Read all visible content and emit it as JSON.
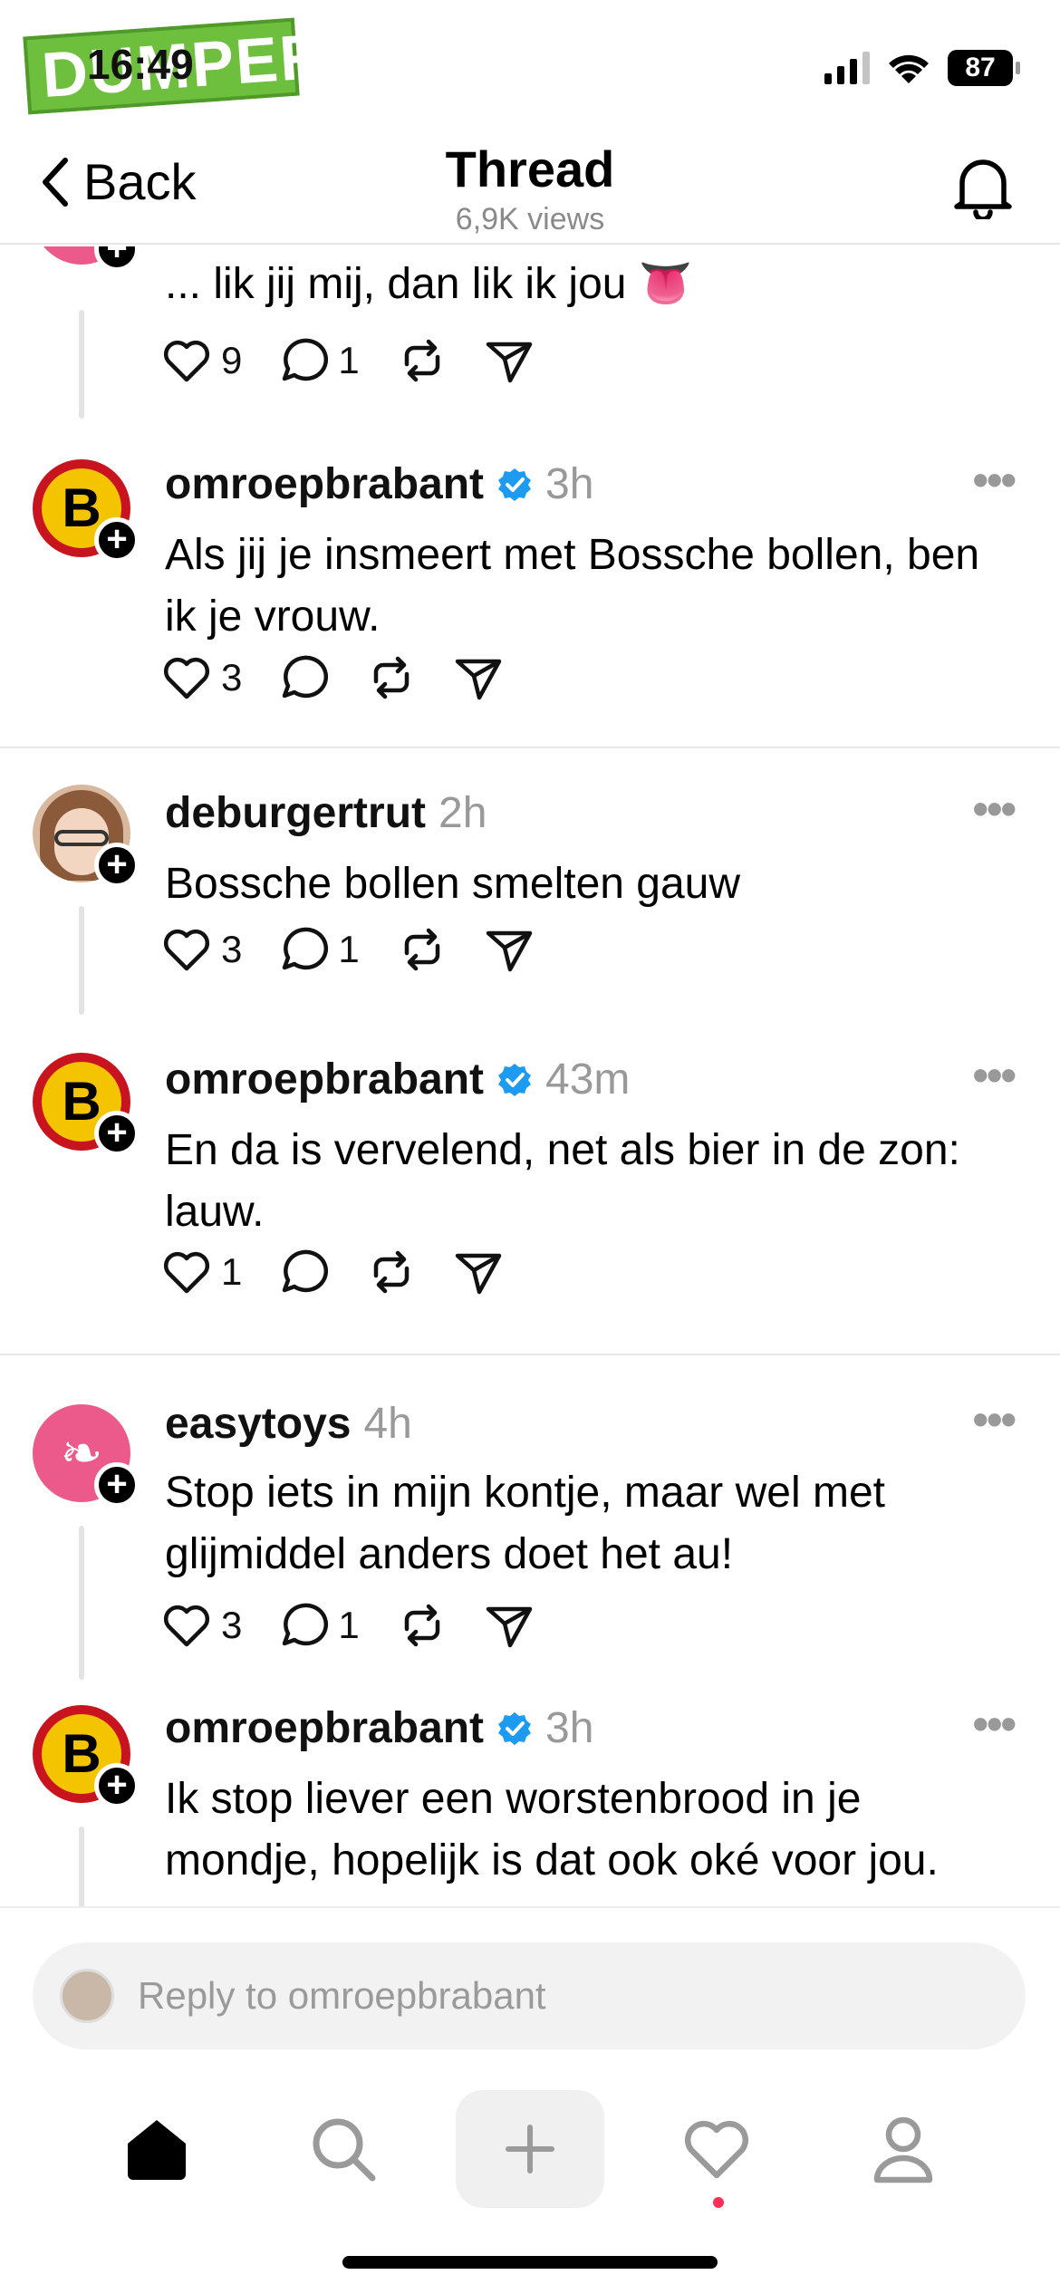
{
  "status_bar": {
    "watermark": "DUMPERT",
    "time": "16:49",
    "battery": "87"
  },
  "header": {
    "back_label": "Back",
    "title": "Thread",
    "views": "6,9K views"
  },
  "posts": [
    {
      "id": "partial",
      "username": "",
      "text": "... lik jij mij, dan lik ik jou 👅",
      "likes": "9",
      "replies": "1",
      "avatar": "easytoys"
    },
    {
      "id": "p1",
      "username": "omroepbrabant",
      "verified": true,
      "time": "3h",
      "text": "Als jij je insmeert met Bossche bollen, ben ik je vrouw.",
      "likes": "3",
      "replies": "",
      "avatar": "B"
    },
    {
      "id": "p2",
      "username": "deburgertrut",
      "verified": false,
      "time": "2h",
      "text": "Bossche bollen smelten gauw",
      "likes": "3",
      "replies": "1",
      "avatar": "person"
    },
    {
      "id": "p3",
      "username": "omroepbrabant",
      "verified": true,
      "time": "43m",
      "text": "En da is vervelend, net als bier in de zon: lauw.",
      "likes": "1",
      "replies": "",
      "avatar": "B"
    },
    {
      "id": "p4",
      "username": "easytoys",
      "verified": false,
      "time": "4h",
      "text": "Stop iets in mijn kontje, maar wel met glijmiddel anders doet het au!",
      "likes": "3",
      "replies": "1",
      "avatar": "easytoys"
    },
    {
      "id": "p5",
      "username": "omroepbrabant",
      "verified": true,
      "time": "3h",
      "text": "Ik stop liever een worstenbrood in je mondje, hopelijk is dat ook oké voor jou.",
      "likes": "",
      "replies": "",
      "avatar": "B"
    }
  ],
  "avatar_letter": "B",
  "more_label": "•••",
  "reply_bar": {
    "placeholder": "Reply to omroepbrabant"
  },
  "tabs": [
    "home-icon",
    "search-icon",
    "new-post-icon",
    "activity-icon",
    "profile-icon"
  ],
  "colors": {
    "verified": "#1d9bf0",
    "notification_dot": "#ff2f55",
    "omroep_red": "#c8141e",
    "omroep_yellow": "#f5c400",
    "easytoys_pink": "#ec5a8c"
  }
}
